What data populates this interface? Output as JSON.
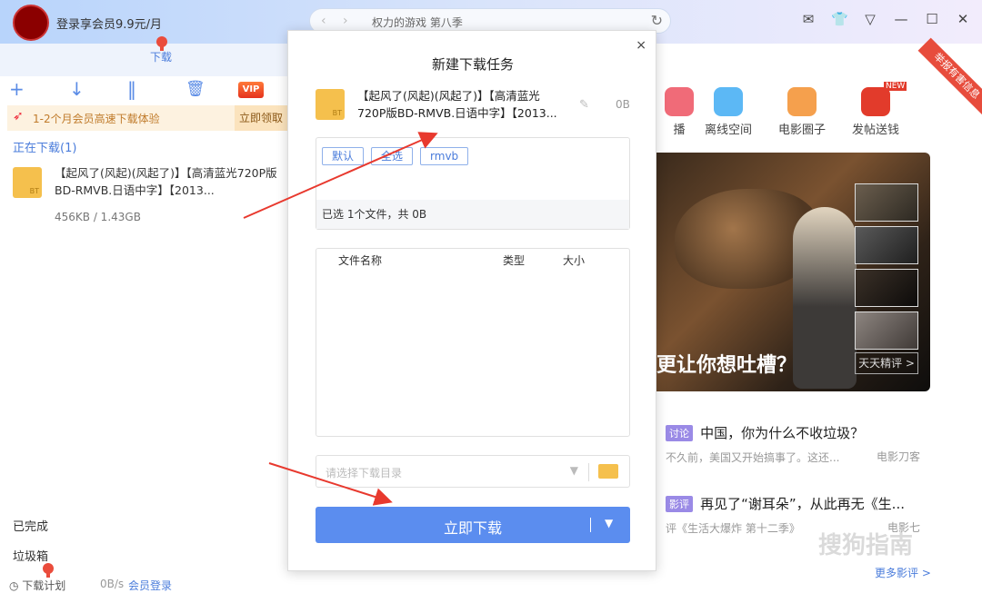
{
  "titlebar": {
    "login_promo": "登录享会员9.9元/月",
    "search_query": "权力的游戏 第八季",
    "window_icons": [
      "mail-icon",
      "skin-icon",
      "menu-icon",
      "minimize-icon",
      "maximize-icon",
      "close-icon"
    ]
  },
  "left": {
    "tab": "下载",
    "vip_label": "VIP",
    "promo_text": "1-2个月会员高速下载体验",
    "promo_btn": "立即领取",
    "downloading_header": "正在下载(1)",
    "item": {
      "name": "【起风了(风起)(风起了)】【高清蓝光720P版BD-RMVB.日语中字】【2013...",
      "size": "456KB / 1.43GB",
      "badge": "BT"
    },
    "completed": "已完成",
    "trash": "垃圾箱",
    "status": {
      "plan": "下载计划",
      "speed": "0B/s",
      "member_login": "会员登录"
    }
  },
  "dialog": {
    "title": "新建下载任务",
    "close": "×",
    "task_name": "【起风了(风起)(风起了)】【高清蓝光720P版BD-RMVB.日语中字】【2013...",
    "task_size": "0B",
    "task_badge": "BT",
    "chips": [
      "默认",
      "全选",
      "rmvb"
    ],
    "selection_info": "已选 1个文件，共 0B",
    "table_headers": {
      "name": "文件名称",
      "type": "类型",
      "size": "大小"
    },
    "dir_placeholder": "请选择下载目录",
    "download_button": "立即下载"
  },
  "right": {
    "apps": [
      {
        "label": "播",
        "color": "#f06b78"
      },
      {
        "label": "离线空间",
        "color": "#5cb8f5"
      },
      {
        "label": "电影圈子",
        "color": "#f5a04d"
      },
      {
        "label": "发帖送钱",
        "color": "#e23b2b"
      }
    ],
    "new_badge": "NEW",
    "report_ribbon": "举报有害信息",
    "banner_headline": "更让你想吐槽？",
    "thumb_button": "天天精评 >",
    "news": [
      {
        "tag": "讨论",
        "title": "中国，你为什么不收垃圾？",
        "sub": "不久前，美国又开始搞事了。这还...",
        "source": "电影刀客"
      },
      {
        "tag": "影评",
        "title": "再见了“谢耳朵”，从此再无《生...",
        "sub": "评《生活大爆炸 第十二季》",
        "source": "电影七"
      }
    ],
    "more_reviews": "更多影评 >",
    "watermark": "搜狗指南"
  },
  "colors": {
    "accent": "#5b8def",
    "promo_bg": "#fdf2e0",
    "arrow": "#e8392e"
  }
}
